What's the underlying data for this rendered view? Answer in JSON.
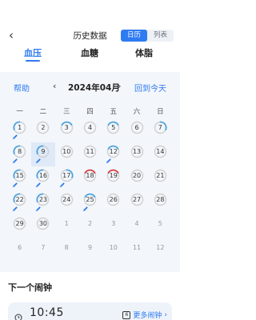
{
  "header": {
    "back_icon": "chevron-left-icon",
    "title": "历史数据",
    "view_toggle": [
      "日历",
      "列表"
    ],
    "active_view": "日历"
  },
  "tabs": [
    {
      "label": "血压",
      "active": true
    },
    {
      "label": "血糖",
      "active": false
    },
    {
      "label": "体脂",
      "active": false
    }
  ],
  "calendar": {
    "help_label": "帮助",
    "month_label": "2024年04月",
    "today_label": "回到今天",
    "weekdays": [
      "一",
      "二",
      "三",
      "四",
      "五",
      "六",
      "日"
    ],
    "colors": {
      "blue": "#4aa3df",
      "red": "#d63b3b",
      "gray": "#cfcfcf",
      "pen": "#2f7bf2",
      "selected_bg": "#dfe9f7"
    },
    "weeks": [
      [
        {
          "day": "1",
          "ring": "blue",
          "arc": "left",
          "pen": true
        },
        {
          "day": "2",
          "ring": "gray"
        },
        {
          "day": "3",
          "ring": "blue",
          "arc": "top"
        },
        {
          "day": "4",
          "ring": "gray"
        },
        {
          "day": "5",
          "ring": "blue",
          "arc": "top"
        },
        {
          "day": "6",
          "ring": "gray"
        },
        {
          "day": "7",
          "ring": "blue",
          "arc": "right"
        }
      ],
      [
        {
          "day": "8",
          "ring": "blue",
          "arc": "left",
          "pen": true
        },
        {
          "day": "9",
          "ring": "blue",
          "arc": "left",
          "pen": true,
          "selected": true
        },
        {
          "day": "10",
          "ring": "gray"
        },
        {
          "day": "11",
          "ring": "gray"
        },
        {
          "day": "12",
          "ring": "blue",
          "arc": "top",
          "pen": true
        },
        {
          "day": "13",
          "ring": "gray"
        },
        {
          "day": "14",
          "ring": "gray"
        }
      ],
      [
        {
          "day": "15",
          "ring": "blue",
          "arc": "left",
          "pen": true
        },
        {
          "day": "16",
          "ring": "blue",
          "arc": "left",
          "pen": true
        },
        {
          "day": "17",
          "ring": "blue",
          "arc": "right",
          "pen": true
        },
        {
          "day": "18",
          "ring": "red",
          "arc": "top"
        },
        {
          "day": "19",
          "ring": "red",
          "arc": "top"
        },
        {
          "day": "20",
          "ring": "gray"
        },
        {
          "day": "21",
          "ring": "gray"
        }
      ],
      [
        {
          "day": "22",
          "ring": "blue",
          "arc": "left",
          "pen": true
        },
        {
          "day": "23",
          "ring": "blue",
          "arc": "left",
          "pen": true
        },
        {
          "day": "24",
          "ring": "gray"
        },
        {
          "day": "25",
          "ring": "blue",
          "arc": "top",
          "pen": true
        },
        {
          "day": "26",
          "ring": "gray"
        },
        {
          "day": "27",
          "ring": "gray"
        },
        {
          "day": "28",
          "ring": "gray"
        }
      ],
      [
        {
          "day": "29",
          "ring": "gray"
        },
        {
          "day": "30",
          "ring": "gray"
        },
        {
          "day": "1",
          "other": true
        },
        {
          "day": "2",
          "other": true
        },
        {
          "day": "3",
          "other": true
        },
        {
          "day": "4",
          "other": true
        },
        {
          "day": "5",
          "other": true
        }
      ],
      [
        {
          "day": "6",
          "other": true
        },
        {
          "day": "7",
          "other": true
        },
        {
          "day": "8",
          "other": true
        },
        {
          "day": "9",
          "other": true
        },
        {
          "day": "10",
          "other": true
        },
        {
          "day": "11",
          "other": true
        },
        {
          "day": "12",
          "other": true
        }
      ]
    ]
  },
  "alarm": {
    "section_title": "下一个闹钟",
    "time": "10:45",
    "more_label": "更多闹钟",
    "more_icon_number": "6"
  }
}
